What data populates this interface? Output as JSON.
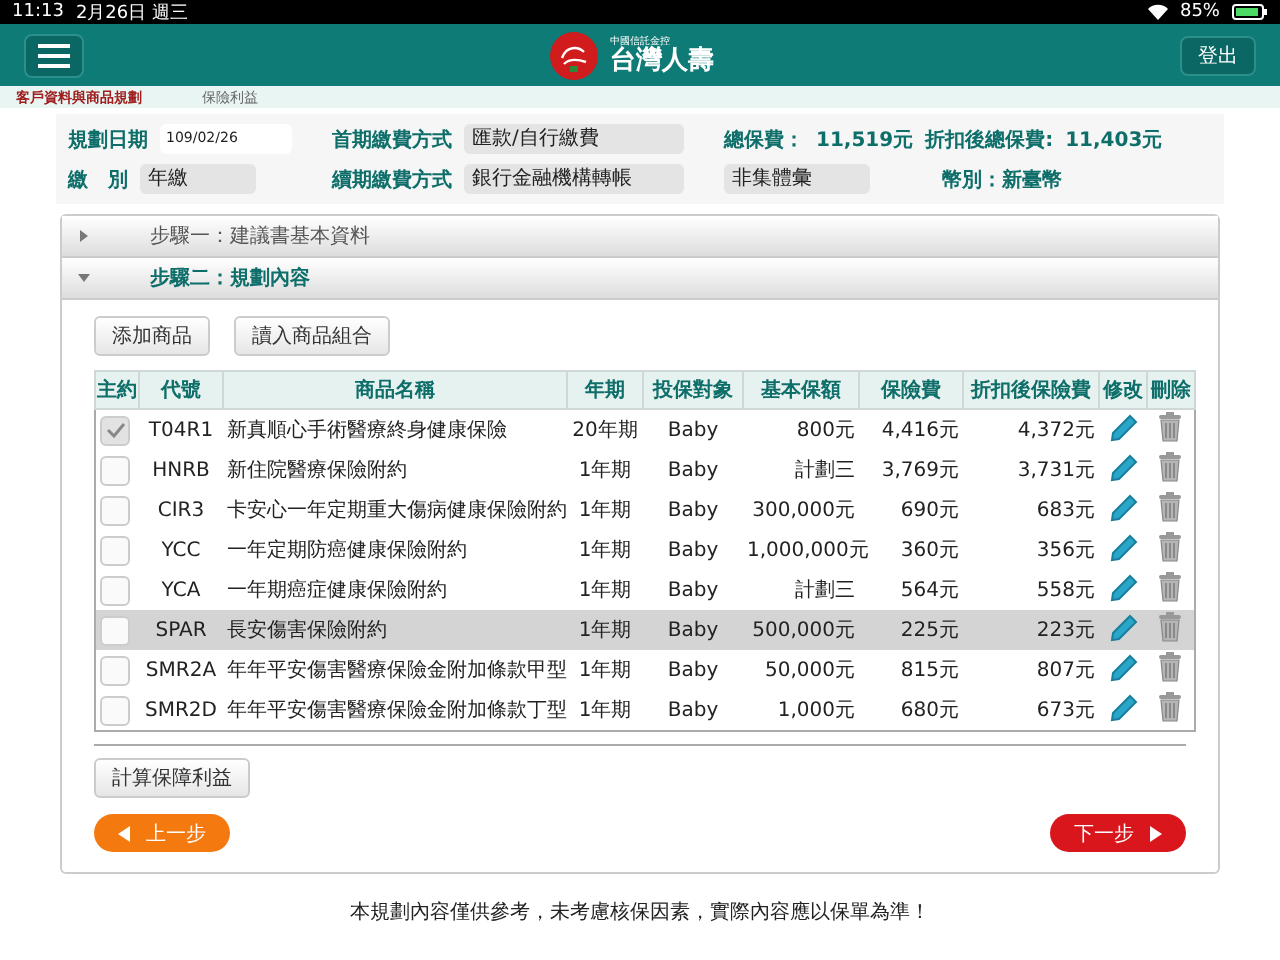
{
  "status_bar": {
    "time": "11:13",
    "date": "2月26日 週三",
    "battery": "85%"
  },
  "header": {
    "group_name": "中國信託金控",
    "brand": "台灣人壽",
    "logout": "登出"
  },
  "breadcrumb": [
    {
      "label": "客戶資料與商品規劃",
      "selected": true
    },
    {
      "label": "保險利益",
      "selected": false
    }
  ],
  "form": {
    "plan_date": {
      "label": "規劃日期",
      "value": "109/02/26"
    },
    "pay_mode": {
      "label": "繳　別",
      "value": "年繳"
    },
    "first_payment": {
      "label": "首期繳費方式",
      "value": "匯款/自行繳費"
    },
    "renewal_payment": {
      "label": "續期繳費方式",
      "value": "銀行金融機構轉帳"
    },
    "group_billing": {
      "value": "非集體彙"
    },
    "total_label": "總保費：",
    "total": "11,519元",
    "discount_label": "折扣後總保費:",
    "discount_total": "11,403元",
    "currency": "幣別：新臺幣"
  },
  "steps": [
    {
      "label": "步驟一：建議書基本資料",
      "expanded": false
    },
    {
      "label": "步驟二：規劃內容",
      "expanded": true
    }
  ],
  "actions": [
    "添加商品",
    "讀入商品組合"
  ],
  "table": {
    "columns": [
      "主約",
      "代號",
      "商品名稱",
      "年期",
      "投保對象",
      "基本保額",
      "保險費",
      "折扣後保險費",
      "修改",
      "刪除"
    ],
    "rows": [
      {
        "checked": true,
        "selected": false,
        "code": "T04R1",
        "name": "新真順心手術醫療終身健康保險",
        "term": "20年期",
        "insured": "Baby",
        "sum": "800元",
        "premium": "4,416元",
        "discounted": "4,372元"
      },
      {
        "checked": false,
        "selected": false,
        "code": "HNRB",
        "name": "新住院醫療保險附約",
        "term": "1年期",
        "insured": "Baby",
        "sum": "計劃三",
        "premium": "3,769元",
        "discounted": "3,731元"
      },
      {
        "checked": false,
        "selected": false,
        "code": "CIR3",
        "name": "卡安心一年定期重大傷病健康保險附約",
        "term": "1年期",
        "insured": "Baby",
        "sum": "300,000元",
        "premium": "690元",
        "discounted": "683元"
      },
      {
        "checked": false,
        "selected": false,
        "code": "YCC",
        "name": "一年定期防癌健康保險附約",
        "term": "1年期",
        "insured": "Baby",
        "sum": "1,000,000元",
        "premium": "360元",
        "discounted": "356元"
      },
      {
        "checked": false,
        "selected": false,
        "code": "YCA",
        "name": "一年期癌症健康保險附約",
        "term": "1年期",
        "insured": "Baby",
        "sum": "計劃三",
        "premium": "564元",
        "discounted": "558元"
      },
      {
        "checked": false,
        "selected": true,
        "code": "SPAR",
        "name": "長安傷害保險附約",
        "term": "1年期",
        "insured": "Baby",
        "sum": "500,000元",
        "premium": "225元",
        "discounted": "223元"
      },
      {
        "checked": false,
        "selected": false,
        "code": "SMR2A",
        "name": "年年平安傷害醫療保險金附加條款甲型",
        "term": "1年期",
        "insured": "Baby",
        "sum": "50,000元",
        "premium": "815元",
        "discounted": "807元"
      },
      {
        "checked": false,
        "selected": false,
        "code": "SMR2D",
        "name": "年年平安傷害醫療保險金附加條款丁型",
        "term": "1年期",
        "insured": "Baby",
        "sum": "1,000元",
        "premium": "680元",
        "discounted": "673元"
      }
    ]
  },
  "calculate_button": "計算保障利益",
  "prev_button": "上一步",
  "next_button": "下一步",
  "footer_note": "本規劃內容僅供參考，未考慮核保因素，實際內容應以保單為準！"
}
